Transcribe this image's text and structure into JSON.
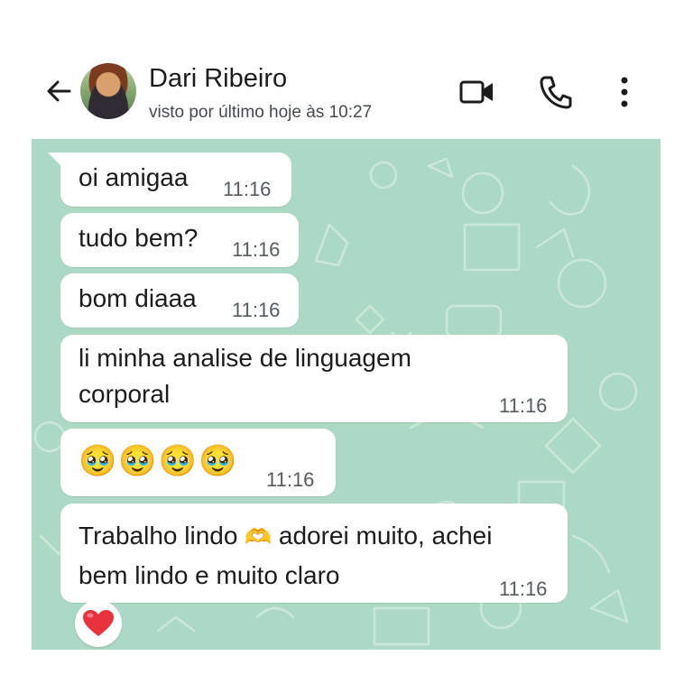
{
  "header": {
    "contact_name": "Dari Ribeiro",
    "last_seen": "visto por último hoje às 10:27",
    "icons": [
      "back-arrow-icon",
      "video-call-icon",
      "phone-icon",
      "more-vertical-icon"
    ]
  },
  "colors": {
    "chat_background": "#acd9c5",
    "bubble": "#ffffff",
    "text": "#1c1c1c",
    "time": "#555b5f"
  },
  "messages": [
    {
      "text": "oi amigaa",
      "time": "11:16"
    },
    {
      "text": "tudo bem?",
      "time": "11:16"
    },
    {
      "text": "bom diaaa",
      "time": "11:16"
    },
    {
      "line1": "li minha analise de linguagem",
      "line2": "corporal",
      "time": "11:16"
    },
    {
      "emoji": "🥹🥹🥹🥹",
      "time": "11:16"
    },
    {
      "line1_a": "Trabalho lindo",
      "line1_emoji": "🫶",
      "line1_b": "adorei muito, achei",
      "line2": "bem lindo e muito claro",
      "time": "11:16",
      "reaction": "❤️"
    }
  ]
}
